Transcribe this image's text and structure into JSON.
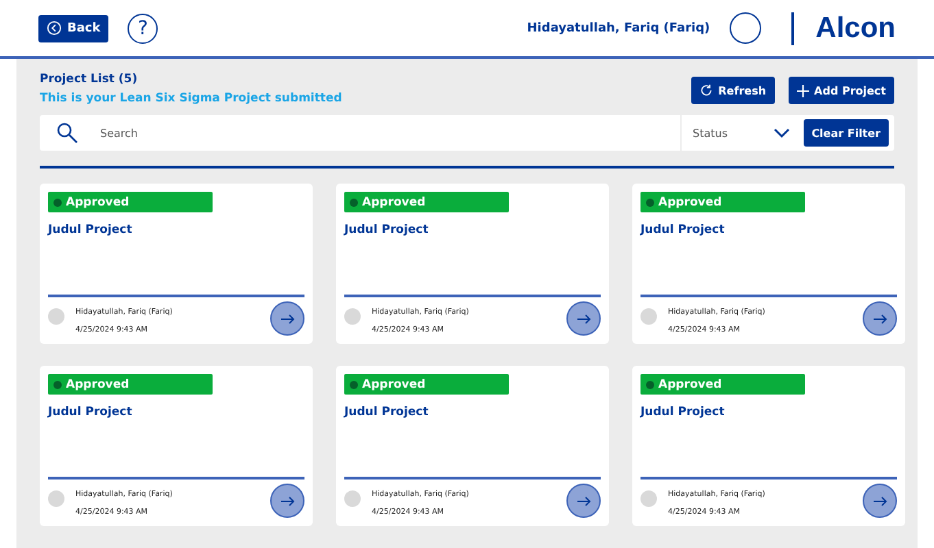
{
  "header": {
    "back_label": "Back",
    "help_label": "?",
    "user_name": "Hidayatullah, Fariq (Fariq)",
    "logo": "Alcon"
  },
  "list": {
    "title": "Project List (5)",
    "subtitle": "This is your Lean Six Sigma Project submitted",
    "refresh_label": "Refresh",
    "add_label": "Add Project"
  },
  "filter": {
    "search_placeholder": "Search",
    "status_placeholder": "Status",
    "clear_label": "Clear Filter"
  },
  "projects": [
    {
      "status": "Approved",
      "title": "Judul Project",
      "owner": "Hidayatullah, Fariq (Fariq)",
      "date": "4/25/2024 9:43 AM"
    },
    {
      "status": "Approved",
      "title": "Judul Project",
      "owner": "Hidayatullah, Fariq (Fariq)",
      "date": "4/25/2024 9:43 AM"
    },
    {
      "status": "Approved",
      "title": "Judul Project",
      "owner": "Hidayatullah, Fariq (Fariq)",
      "date": "4/25/2024 9:43 AM"
    },
    {
      "status": "Approved",
      "title": "Judul Project",
      "owner": "Hidayatullah, Fariq (Fariq)",
      "date": "4/25/2024 9:43 AM"
    },
    {
      "status": "Approved",
      "title": "Judul Project",
      "owner": "Hidayatullah, Fariq (Fariq)",
      "date": "4/25/2024 9:43 AM"
    },
    {
      "status": "Approved",
      "title": "Judul Project",
      "owner": "Hidayatullah, Fariq (Fariq)",
      "date": "4/25/2024 9:43 AM"
    }
  ]
}
